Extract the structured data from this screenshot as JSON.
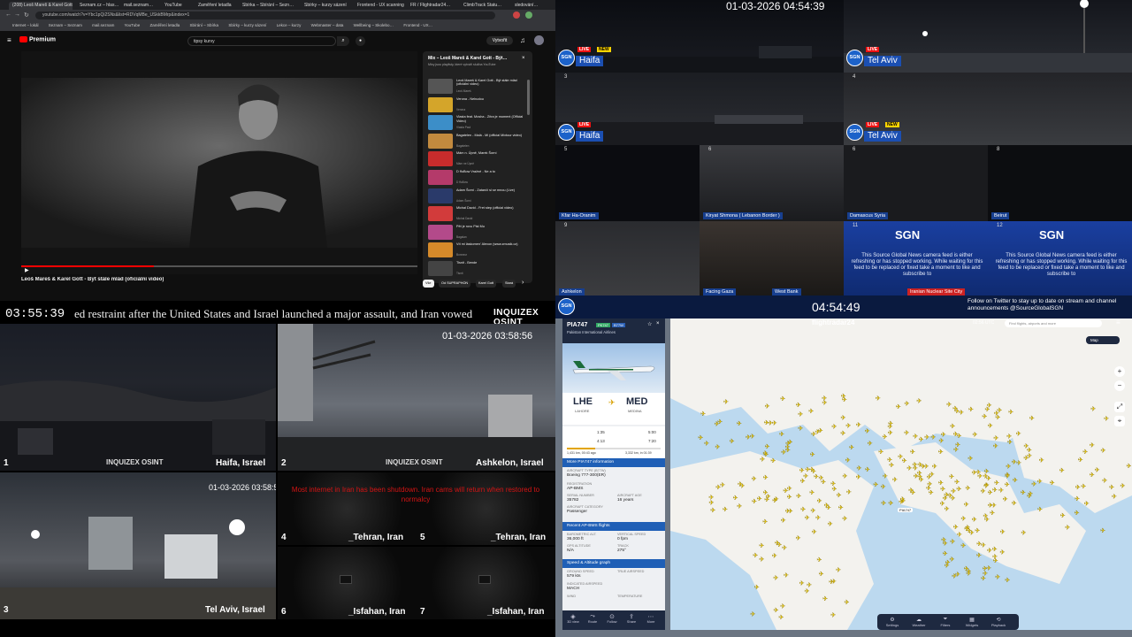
{
  "youtube": {
    "tabs": [
      "(208) Leoš Mareš & Karel Gott",
      "Seznam.cz – hlas…",
      "mail.seznam…",
      "YouTube",
      "Zaměření letadla",
      "Sbírka – Sbírání – Sezn…",
      "Sbírky – kurzy sázení",
      "Gallery – Scanner…",
      "Wellbeing – Skolebo…",
      "Frontend - UX scanning",
      "FR / Flightradar24…",
      "ClimbTrack Statu…",
      "sledování…"
    ],
    "url": "youtube.com/watch?v=Ybc1pQi2SNs&list=RDVqMBe_USkkBMrp&index=1",
    "bookmarks": [
      "Internet – lokál",
      "Seznam – Seznam",
      "mail.seznam",
      "YouTube",
      "Zaměření letadla",
      "Sbírání – Sbírka",
      "Sbírky – kurzy sázení",
      "Lekce – kurzy",
      "Webmaster – data",
      "Wellbeing – Skolebo…",
      "Frontend - UX…",
      "FR / Flightradar24…",
      "ClimbTrack Statu…",
      "Všechny záložky"
    ],
    "logo": "Premium",
    "search": "tipsy kurvy",
    "create": "Vytvořit",
    "title": "Leoš Mareš & Karel Gott - Být stále mlád (oficiální video)",
    "mix": {
      "title": "Mix – Leoš Mareš & Karel Gott - Být…",
      "subtitle": "Mixy jsou playlisty, které vytváří služba YouTube",
      "items": [
        {
          "title": "Leoš Mareš & Karel Gott - Být stále mlád (oficiální video)",
          "artist": "Leoš Mareš",
          "color": "#555"
        },
        {
          "title": "Verona - Nebudou",
          "artist": "Verona",
          "color": "#d4a52a"
        },
        {
          "title": "Vlasta feat. Mosha - Zítra je moment (Official Video)",
          "artist": "Vlasta Paul",
          "color": "#3c8ec8"
        },
        {
          "title": "Bagatelen - Malá - Mi (official Mixtour video)",
          "artist": "Bagatelen",
          "color": "#c28a3e"
        },
        {
          "title": "Mám n. Úpně, Marek Šorní",
          "artist": "Mám ne Úpně",
          "color": "#c82c2c"
        },
        {
          "title": "D ffuBow Vražné - Ne a to",
          "artist": "D ffuBow",
          "color": "#b43a6a"
        },
        {
          "title": "Adam Šorní - Zatančí si se mnou (Live)",
          "artist": "Adam Šorní",
          "color": "#2a3a6a"
        },
        {
          "title": "Michal David - Fret step (official video)",
          "artist": "Michal David",
          "color": "#d23b3b"
        },
        {
          "title": "Pět je rovu Pist Mu",
          "artist": "Bagalan",
          "color": "#b34a8a"
        },
        {
          "title": "Vít mi láskomen' Alexon (www.zmusik.cz)",
          "artist": "Bonneur",
          "color": "#d58a2a"
        },
        {
          "title": "Tisnit - Bende",
          "artist": "Tisnit",
          "color": "#444"
        }
      ]
    },
    "chips": [
      "Vše",
      "Od SUPRAPHON",
      "Karel Gott",
      "Stará"
    ]
  },
  "sgn": {
    "clock_top": "01-03-2026 04:54:39",
    "clock_bottom": "04:54:49",
    "logo": "SGN",
    "live": "LIVE",
    "new": "NEW",
    "big": [
      {
        "num": "1",
        "city": "Haifa",
        "new": true
      },
      {
        "num": "2",
        "city": "Tel Aviv",
        "new": false
      },
      {
        "num": "3",
        "city": "Haifa",
        "new": false
      },
      {
        "num": "4",
        "city": "Tel Aviv",
        "new": true
      }
    ],
    "small": [
      {
        "num": "5",
        "label": "Kfar Ha-Oranim"
      },
      {
        "num": "6",
        "label": "Kiryat Shmona ( Lebanon Border )"
      },
      {
        "num": "7",
        "label": "Damascus Syria"
      },
      {
        "num": "8",
        "label": "Beirut"
      },
      {
        "num": "9",
        "label": "Ashkelon"
      },
      {
        "num": "10",
        "label": "Facing Gaza"
      },
      {
        "num": "10b",
        "label": "West Bank"
      }
    ],
    "promo": {
      "logo": "SGN",
      "text": "This Source Global News camera feed is either refreshing or has stopped working. While waiting for this feed to be replaced or fixed take a moment to like and subscribe to",
      "label_11": "Tehran, Iran",
      "label_12": "Iranian Nuclear Site City"
    },
    "follow": "Follow on Twitter to stay up to date on stream and channel announcements @SourceGlobalSGN"
  },
  "osint": {
    "clock": "03:55:39",
    "ticker": "ed restraint after the United States and Israel launched a major assault, and Iran vowed",
    "brand": "INQUIZEX OSINT",
    "cells": [
      {
        "num": "1",
        "place": "Haifa, Israel",
        "stamp": ""
      },
      {
        "num": "2",
        "place": "Ashkelon, Israel",
        "stamp": "01-03-2026 03:58:56"
      },
      {
        "num": "3",
        "place": "Tel Aviv, Israel",
        "stamp": "01-03-2026 03:58:56"
      },
      {
        "num": "4",
        "place": "_Tehran, Iran",
        "stamp": ""
      },
      {
        "num": "5",
        "place": "_Tehran, Iran",
        "stamp": ""
      },
      {
        "num": "6",
        "place": "_Isfahan, Iran",
        "stamp": ""
      },
      {
        "num": "7",
        "place": "_Isfahan, Iran",
        "stamp": ""
      }
    ],
    "warning": "Most internet in Iran has been shutdown. Iran cams will return when restored to normalcy"
  },
  "flightradar": {
    "brand": "flightradar24",
    "search_placeholder": "Find flights, airports and more",
    "clock": "02:56 UTC",
    "callsign": "PIA747",
    "tag1": "PK747",
    "tag2": "B77W",
    "airline": "Pakistan International Airlines",
    "from_code": "LHE",
    "from_city": "LAHORE",
    "to_code": "MED",
    "to_city": "MEDINA",
    "sched_dep": "1:35",
    "sched_arr": "5:00",
    "actual_dep": "4:13",
    "est_arr": "7:20",
    "dist_done": "1,431 km, 00:43 ago",
    "dist_left": "3,332 km, in 01:39",
    "sections": [
      "More PIA747 information",
      "Recent AP-BMS flights",
      "Speed & Altitude graph"
    ],
    "fields": [
      {
        "k": "AIRCRAFT TYPE (B77W)",
        "v": "Boeing 777-300(ER)"
      },
      {
        "k": "REGISTRATION",
        "v": "AP-BMS"
      },
      {
        "k": "SERIAL NUMBER",
        "v": "35782"
      },
      {
        "k": "AIRCRAFT AGE",
        "v": "16 years"
      },
      {
        "k": "AIRCRAFT CATEGORY",
        "v": "Passenger"
      },
      {
        "k": "BAROMETRIC ALT.",
        "v": "36,000 ft"
      },
      {
        "k": "VERTICAL SPEED",
        "v": "0 fpm"
      },
      {
        "k": "GPS ALTITUDE",
        "v": "N/A"
      },
      {
        "k": "TRACK",
        "v": "275°"
      },
      {
        "k": "GROUND SPEED",
        "v": "579 kts"
      },
      {
        "k": "TRUE AIRSPEED",
        "v": ""
      },
      {
        "k": "INDICATED AIRSPEED",
        "v": "MACH"
      },
      {
        "k": "WIND",
        "v": ""
      },
      {
        "k": "TEMPERATURE",
        "v": ""
      }
    ],
    "nav": [
      "3D view",
      "Route",
      "Follow",
      "Share",
      "More"
    ],
    "bottom": [
      "Settings",
      "Weather",
      "Filters",
      "Widgets",
      "Playback"
    ],
    "label_plane": "PIA747",
    "map_toggle": "Map"
  }
}
